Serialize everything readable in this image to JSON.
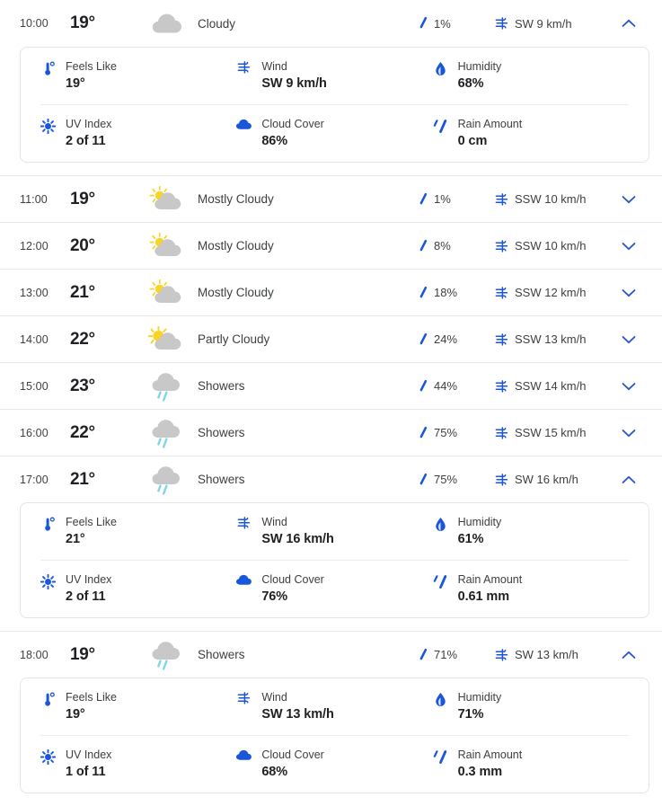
{
  "accent_blue": "#1a56db",
  "chevron_blue": "#2a56c6",
  "cloud_gray": "#c8c8c8",
  "sun_yellow": "#f9d423",
  "rain_cyan": "#7fd4f2",
  "detail_labels": {
    "feels_like": "Feels Like",
    "wind": "Wind",
    "humidity": "Humidity",
    "uv_index": "UV Index",
    "cloud_cover": "Cloud Cover",
    "rain_amount": "Rain Amount"
  },
  "hours": [
    {
      "time": "10:00",
      "temp": "19°",
      "condition": "Cloudy",
      "icon": "cloudy-icon",
      "precip": "1%",
      "wind": "SW 9 km/h",
      "expanded": true,
      "chevron": "chevron-up-icon",
      "details": {
        "feels_like": "19°",
        "wind": "SW 9 km/h",
        "humidity": "68%",
        "uv_index": "2 of 11",
        "cloud_cover": "86%",
        "rain_amount": "0 cm"
      }
    },
    {
      "time": "11:00",
      "temp": "19°",
      "condition": "Mostly Cloudy",
      "icon": "mostly-cloudy-icon",
      "precip": "1%",
      "wind": "SSW 10 km/h",
      "expanded": false,
      "chevron": "chevron-down-icon"
    },
    {
      "time": "12:00",
      "temp": "20°",
      "condition": "Mostly Cloudy",
      "icon": "mostly-cloudy-icon",
      "precip": "8%",
      "wind": "SSW 10 km/h",
      "expanded": false,
      "chevron": "chevron-down-icon"
    },
    {
      "time": "13:00",
      "temp": "21°",
      "condition": "Mostly Cloudy",
      "icon": "mostly-cloudy-icon",
      "precip": "18%",
      "wind": "SSW 12 km/h",
      "expanded": false,
      "chevron": "chevron-down-icon"
    },
    {
      "time": "14:00",
      "temp": "22°",
      "condition": "Partly Cloudy",
      "icon": "partly-cloudy-icon",
      "precip": "24%",
      "wind": "SSW 13 km/h",
      "expanded": false,
      "chevron": "chevron-down-icon"
    },
    {
      "time": "15:00",
      "temp": "23°",
      "condition": "Showers",
      "icon": "showers-icon",
      "precip": "44%",
      "wind": "SSW 14 km/h",
      "expanded": false,
      "chevron": "chevron-down-icon"
    },
    {
      "time": "16:00",
      "temp": "22°",
      "condition": "Showers",
      "icon": "showers-icon",
      "precip": "75%",
      "wind": "SSW 15 km/h",
      "expanded": false,
      "chevron": "chevron-down-icon"
    },
    {
      "time": "17:00",
      "temp": "21°",
      "condition": "Showers",
      "icon": "showers-icon",
      "precip": "75%",
      "wind": "SW 16 km/h",
      "expanded": true,
      "chevron": "chevron-up-icon",
      "details": {
        "feels_like": "21°",
        "wind": "SW 16 km/h",
        "humidity": "61%",
        "uv_index": "2 of 11",
        "cloud_cover": "76%",
        "rain_amount": "0.61 mm"
      }
    },
    {
      "time": "18:00",
      "temp": "19°",
      "condition": "Showers",
      "icon": "showers-icon",
      "precip": "71%",
      "wind": "SW 13 km/h",
      "expanded": true,
      "chevron": "chevron-up-icon",
      "details": {
        "feels_like": "19°",
        "wind": "SW 13 km/h",
        "humidity": "71%",
        "uv_index": "1 of 11",
        "cloud_cover": "68%",
        "rain_amount": "0.3 mm"
      }
    }
  ]
}
